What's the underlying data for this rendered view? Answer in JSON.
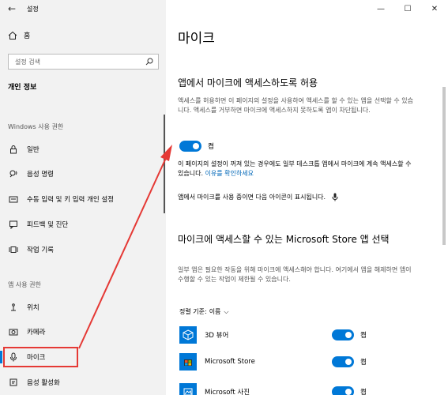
{
  "window": {
    "title": "설정",
    "minimize": "—",
    "maximize": "☐",
    "close": "✕"
  },
  "sidebar": {
    "home_label": "홈",
    "search_placeholder": "설정 검색",
    "section_title": "개인 정보",
    "group_windows": "Windows 사용 권한",
    "windows_items": [
      {
        "label": "일반",
        "icon": "lock-icon"
      },
      {
        "label": "음성 명령",
        "icon": "voice-icon"
      },
      {
        "label": "수동 입력 및 키 입력 개인 설정",
        "icon": "pen-keyboard-icon"
      },
      {
        "label": "피드백 및 진단",
        "icon": "feedback-icon"
      },
      {
        "label": "작업 기록",
        "icon": "timeline-icon"
      }
    ],
    "group_apps": "앱 사용 권한",
    "app_items": [
      {
        "label": "위치",
        "icon": "location-icon"
      },
      {
        "label": "카메라",
        "icon": "camera-icon"
      },
      {
        "label": "마이크",
        "icon": "microphone-icon"
      },
      {
        "label": "음성 활성화",
        "icon": "voice-activation-icon"
      }
    ]
  },
  "main": {
    "title": "마이크",
    "allow_heading": "앱에서 마이크에 액세스하도록 허용",
    "allow_desc": "액세스를 허용하면 이 페이지의 설정을 사용하여 액세스를 할 수 있는 앱을 선택할 수 있습니다. 액세스를 거부하면 마이크에 액세스하지 못하도록 앱이 차단됩니다.",
    "allow_toggle": "켬",
    "info_text": "이 페이지의 설정이 꺼져 있는 경우에도 일부 데스크톱 앱에서 마이크에 계속 액세스할 수 있습니다.",
    "info_link": "이유를 확인하세요",
    "mic_note": "앱에서 마이크를 사용 중이면 다음 아이콘이 표시됩니다.",
    "store_heading": "마이크에 액세스할 수 있는 Microsoft Store 앱 선택",
    "store_desc": "일부 앱은 필요한 작동을 위해 마이크에 액세스해야 합니다. 여기에서 앱을 해제하면 앱이 수행할 수 있는 작업이 제한될 수 있습니다.",
    "sort_label": "정렬 기준:",
    "sort_value": "이름",
    "apps": [
      {
        "name": "3D 뷰어",
        "state": "켬"
      },
      {
        "name": "Microsoft Store",
        "state": "켬"
      },
      {
        "name": "Microsoft 사진",
        "state": "켬"
      }
    ]
  }
}
